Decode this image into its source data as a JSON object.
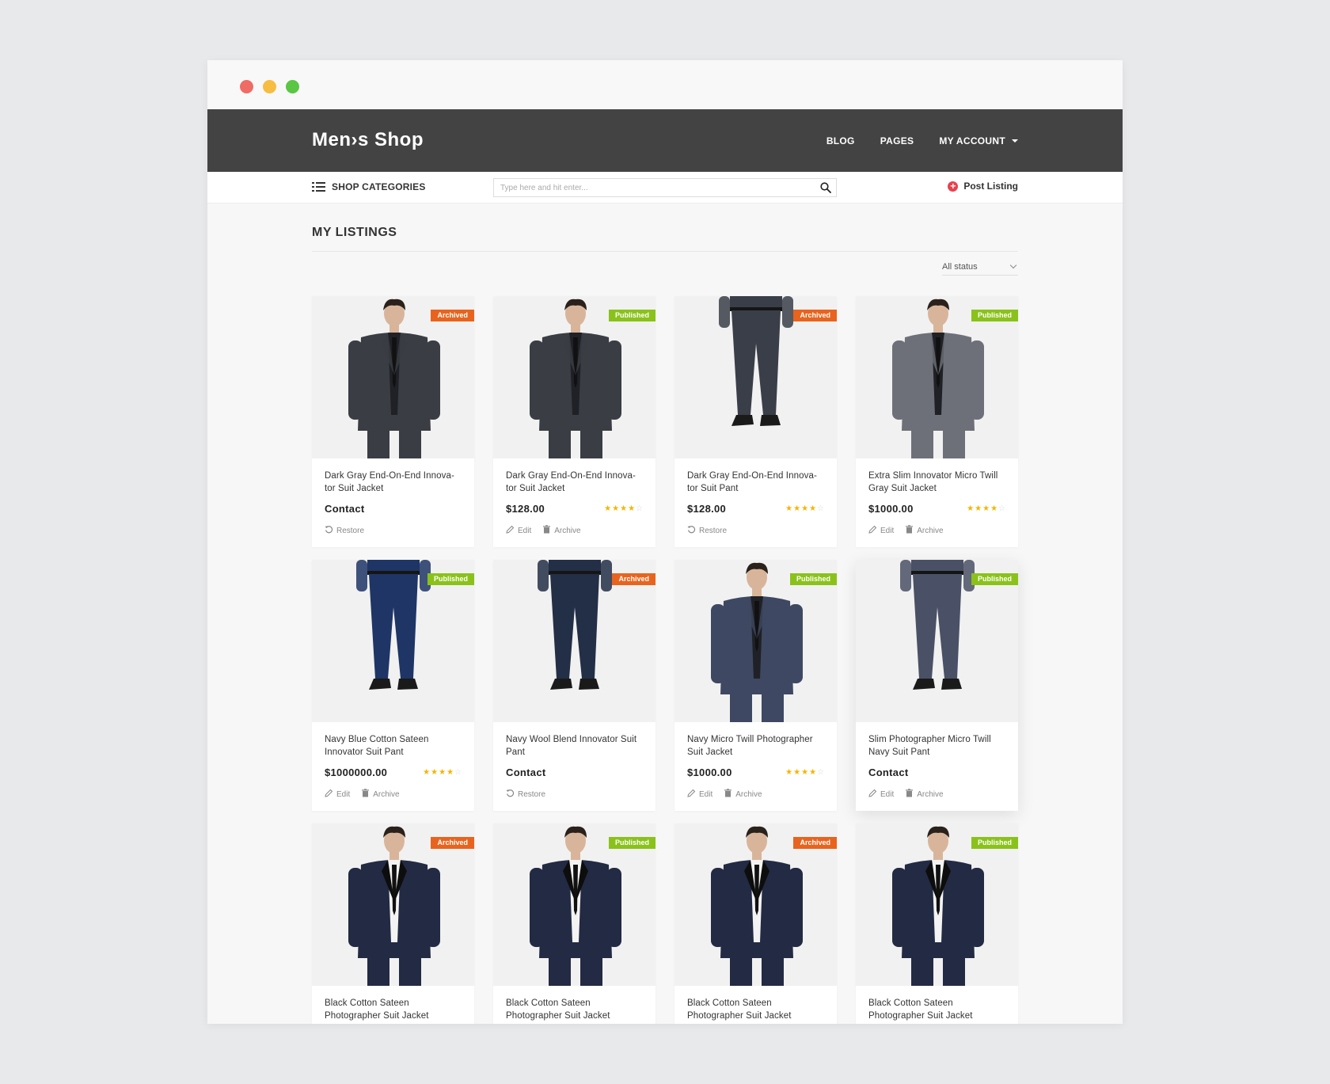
{
  "colors": {
    "navbar": "#434343",
    "archived": "#e8641e",
    "published": "#8ac21b",
    "post": "#e8414e",
    "star": "#f5b400"
  },
  "brand": "Men›s Shop",
  "nav": [
    {
      "label": "BLOG",
      "dropdown": false
    },
    {
      "label": "PAGES",
      "dropdown": false
    },
    {
      "label": "MY ACCOUNT",
      "dropdown": true
    }
  ],
  "subbar": {
    "categories_label": "SHOP CATEGORIES",
    "search_placeholder": "Type here and hit enter...",
    "post_label": "Post Listing"
  },
  "page": {
    "title": "MY LISTINGS",
    "filter": "All status"
  },
  "labels": {
    "edit": "Edit",
    "archive": "Archive",
    "restore": "Restore"
  },
  "listings": [
    {
      "name": "Dark Gray End-On-End Innova-tor Suit Jacket",
      "status": "Archived",
      "price": "Contact",
      "rating": null,
      "type": "jacket",
      "color": "#3a3d44"
    },
    {
      "name": "Dark Gray End-On-End Innova-tor Suit Jacket",
      "status": "Published",
      "price": "$128.00",
      "rating": 4,
      "type": "jacket",
      "color": "#3a3d44"
    },
    {
      "name": "Dark Gray End-On-End Innova-tor Suit Pant",
      "status": "Archived",
      "price": "$128.00",
      "rating": 4,
      "type": "pant",
      "color": "#3a3e48"
    },
    {
      "name": "Extra Slim Innovator Micro Twill Gray Suit Jacket",
      "status": "Published",
      "price": "$1000.00",
      "rating": 4,
      "type": "jacket",
      "color": "#6e7079"
    },
    {
      "name": "Navy Blue Cotton Sateen Innovator Suit Pant",
      "status": "Published",
      "price": "$1000000.00",
      "rating": 4,
      "type": "pant",
      "color": "#1e3566"
    },
    {
      "name": "Navy Wool Blend Innovator Suit Pant",
      "status": "Archived",
      "price": "Contact",
      "rating": null,
      "type": "pant",
      "color": "#232f47"
    },
    {
      "name": "Navy Micro Twill Photographer Suit Jacket",
      "status": "Published",
      "price": "$1000.00",
      "rating": 4,
      "type": "jacket",
      "color": "#3e4862"
    },
    {
      "name": "Slim Photographer Micro Twill Navy Suit Pant",
      "status": "Published",
      "price": "Contact",
      "rating": null,
      "type": "pant",
      "color": "#4a5166"
    },
    {
      "name": "Black Cotton Sateen Photographer Suit Jacket",
      "status": "Archived",
      "price": "",
      "rating": null,
      "type": "tux",
      "color": "#232a44"
    },
    {
      "name": "Black Cotton Sateen Photographer Suit Jacket",
      "status": "Published",
      "price": "",
      "rating": null,
      "type": "tux",
      "color": "#232a44"
    },
    {
      "name": "Black Cotton Sateen Photographer Suit Jacket",
      "status": "Archived",
      "price": "",
      "rating": null,
      "type": "tux",
      "color": "#232a44"
    },
    {
      "name": "Black Cotton Sateen Photographer Suit Jacket",
      "status": "Published",
      "price": "",
      "rating": null,
      "type": "tux",
      "color": "#232a44"
    }
  ]
}
